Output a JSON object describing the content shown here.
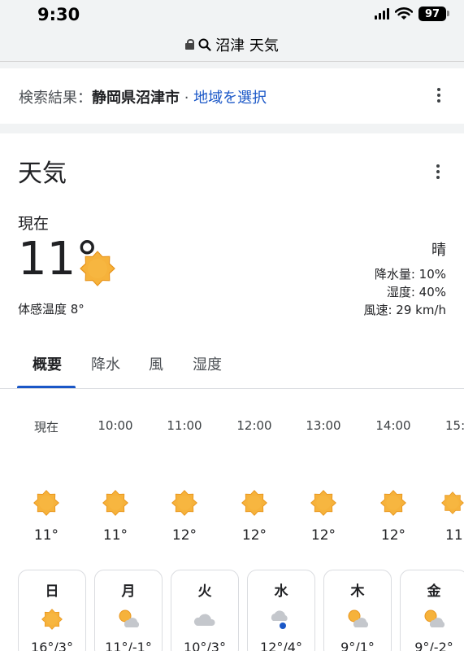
{
  "status": {
    "time": "9:30",
    "battery": "97"
  },
  "url": {
    "query": "沼津 天気"
  },
  "search": {
    "prefix": "検索結果：",
    "location": "静岡県沼津市",
    "separator": " · ",
    "change_link": "地域を選択"
  },
  "weather": {
    "title": "天気",
    "now_label": "現在",
    "temp": "11°",
    "feels_like": "体感温度 8°",
    "condition": "晴",
    "precip": "降水量: 10%",
    "humidity": "湿度: 40%",
    "wind": "風速: 29 km/h"
  },
  "tabs": [
    "概要",
    "降水",
    "風",
    "湿度"
  ],
  "hourly": [
    {
      "label": "現在",
      "icon": "sun-icon",
      "temp": "11°"
    },
    {
      "label": "10:00",
      "icon": "sun-icon",
      "temp": "11°"
    },
    {
      "label": "11:00",
      "icon": "sun-icon",
      "temp": "12°"
    },
    {
      "label": "12:00",
      "icon": "sun-icon",
      "temp": "12°"
    },
    {
      "label": "13:00",
      "icon": "sun-icon",
      "temp": "12°"
    },
    {
      "label": "14:00",
      "icon": "sun-icon",
      "temp": "12°"
    },
    {
      "label": "15:",
      "icon": "sun-icon",
      "temp": "11"
    }
  ],
  "daily": [
    {
      "day": "日",
      "icon": "sun-icon",
      "temps": "16°/3°"
    },
    {
      "day": "月",
      "icon": "sun-cloud-icon",
      "temps": "11°/-1°"
    },
    {
      "day": "火",
      "icon": "cloud-icon",
      "temps": "10°/3°"
    },
    {
      "day": "水",
      "icon": "rain-cloud-icon",
      "temps": "12°/4°"
    },
    {
      "day": "木",
      "icon": "sun-cloud-icon",
      "temps": "9°/1°"
    },
    {
      "day": "金",
      "icon": "sun-cloud-icon",
      "temps": "9°/-2°"
    }
  ],
  "colors": {
    "sun": "#f6b23b",
    "sun_edge": "#e8951c",
    "link": "#1a57c7",
    "cloud": "#c4c7cc",
    "rain": "#1a57c7"
  }
}
